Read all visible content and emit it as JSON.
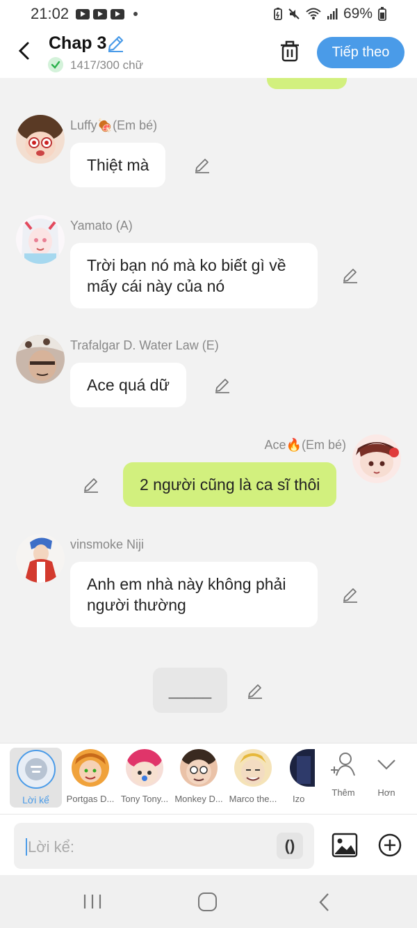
{
  "status_bar": {
    "time": "21:02",
    "battery": "69%",
    "icons": [
      "youtube-icon",
      "youtube-icon",
      "youtube-icon",
      "dot-icon",
      "battery-saver-icon",
      "mute-icon",
      "wifi-icon",
      "signal-icon",
      "battery-icon"
    ]
  },
  "header": {
    "title": "Chap 3",
    "word_count": "1417/300 chữ",
    "follow_label": "Tiếp theo"
  },
  "messages": [
    {
      "sender": "Luffy🍖(Em bé)",
      "text": "Thiệt mà"
    },
    {
      "sender": "Yamato (A)",
      "text": "Trời bạn nó mà ko biết gì về mấy cái này của nó"
    },
    {
      "sender": "Trafalgar D. Water Law (E)",
      "text": "Ace quá dữ"
    },
    {
      "sender": "Ace🔥(Em bé)",
      "text": "2 người cũng là ca sĩ thôi"
    },
    {
      "sender": "vinsmoke Niji",
      "text": "Anh em nhà này không phải người thường"
    },
    {
      "sender": "",
      "text": "_____"
    }
  ],
  "character_bar": {
    "narrator_label": "Lời kể",
    "characters": [
      {
        "name": "Portgas D..."
      },
      {
        "name": "Tony Tony..."
      },
      {
        "name": "Monkey D..."
      },
      {
        "name": "Marco the..."
      },
      {
        "name": "Izo"
      }
    ],
    "add_label": "Thêm",
    "more_label": "Hơn"
  },
  "input": {
    "placeholder": "Lời kể:",
    "paren_label": "()"
  },
  "colors": {
    "accent": "#4a9be8",
    "user_bubble": "#d2f07e",
    "other_bubble": "#ffffff",
    "background": "#f2f2f2"
  }
}
